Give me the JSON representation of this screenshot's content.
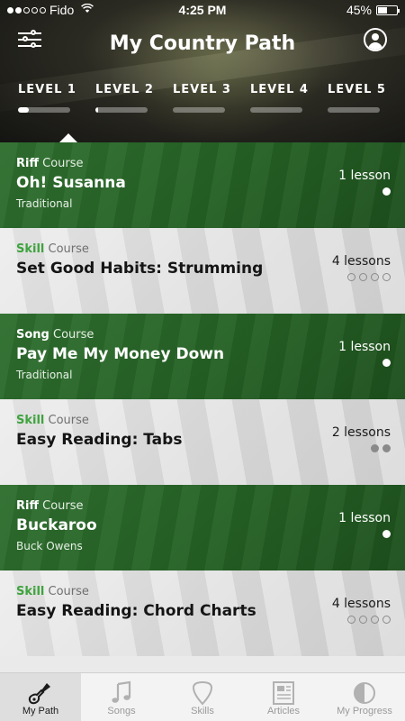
{
  "status_bar": {
    "carrier": "Fido",
    "time": "4:25 PM",
    "battery": "45%"
  },
  "header": {
    "title": "My Country Path",
    "levels": [
      {
        "label": "LEVEL 1",
        "progress": 0.2
      },
      {
        "label": "LEVEL 2",
        "progress": 0.06
      },
      {
        "label": "LEVEL 3",
        "progress": 0
      },
      {
        "label": "LEVEL 4",
        "progress": 0
      },
      {
        "label": "LEVEL 5",
        "progress": 0
      }
    ],
    "selected_level": "LEVEL 1"
  },
  "courses": [
    {
      "kind": "Riff",
      "course_word": "Course",
      "name": "Oh! Susanna",
      "artist": "Traditional",
      "lessons": "1 lesson",
      "style": "green",
      "dots": [
        1
      ]
    },
    {
      "kind": "Skill",
      "course_word": "Course",
      "name": "Set Good Habits: Strumming",
      "artist": "",
      "lessons": "4 lessons",
      "style": "light",
      "dots": [
        0,
        0,
        0,
        0
      ]
    },
    {
      "kind": "Song",
      "course_word": "Course",
      "name": "Pay Me My Money Down",
      "artist": "Traditional",
      "lessons": "1 lesson",
      "style": "green",
      "dots": [
        1
      ]
    },
    {
      "kind": "Skill",
      "course_word": "Course",
      "name": "Easy Reading: Tabs",
      "artist": "",
      "lessons": "2 lessons",
      "style": "light",
      "dots": [
        1,
        1
      ]
    },
    {
      "kind": "Riff",
      "course_word": "Course",
      "name": "Buckaroo",
      "artist": "Buck Owens",
      "lessons": "1 lesson",
      "style": "green",
      "dots": [
        1
      ]
    },
    {
      "kind": "Skill",
      "course_word": "Course",
      "name": "Easy Reading: Chord Charts",
      "artist": "",
      "lessons": "4 lessons",
      "style": "light",
      "dots": [
        0,
        0,
        0,
        0
      ]
    }
  ],
  "tabbar": {
    "tabs": [
      {
        "label": "My Path",
        "icon": "guitar-icon",
        "active": true
      },
      {
        "label": "Songs",
        "icon": "music-note-icon",
        "active": false
      },
      {
        "label": "Skills",
        "icon": "guitar-pick-icon",
        "active": false
      },
      {
        "label": "Articles",
        "icon": "newspaper-icon",
        "active": false
      },
      {
        "label": "My Progress",
        "icon": "half-circle-icon",
        "active": false
      }
    ]
  },
  "colors": {
    "green": "#2a6a2a",
    "skill_accent": "#3fa33f"
  }
}
